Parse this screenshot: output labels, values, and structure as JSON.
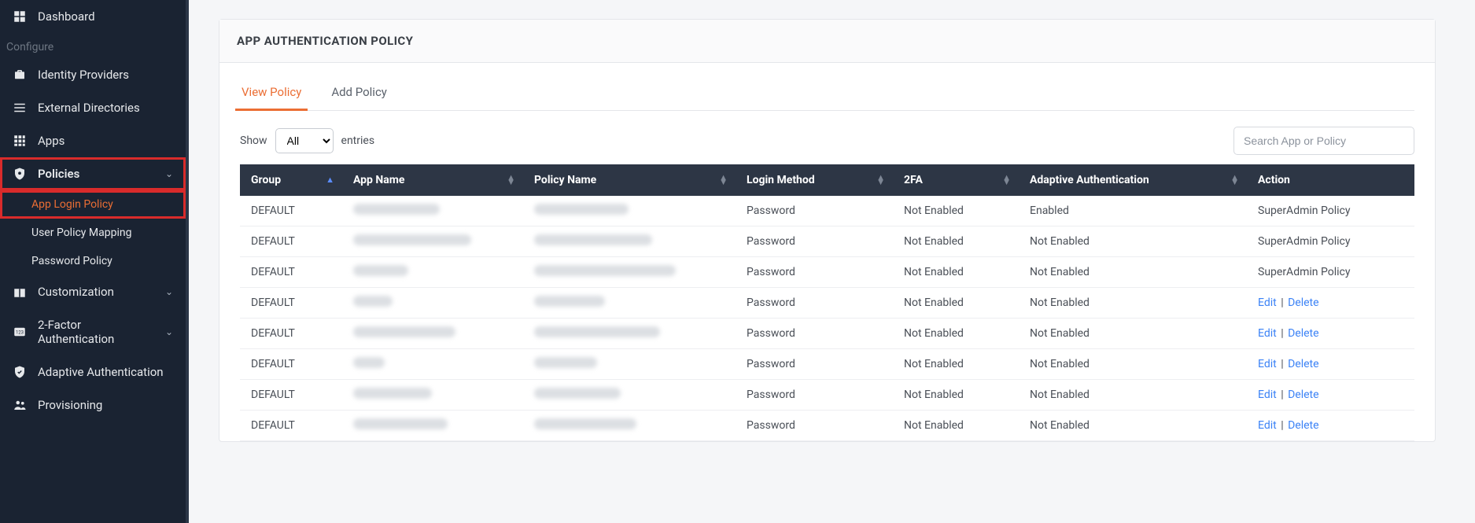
{
  "sidebar": {
    "dashboard": "Dashboard",
    "configure_label": "Configure",
    "identity_providers": "Identity Providers",
    "external_directories": "External Directories",
    "apps": "Apps",
    "policies": "Policies",
    "policies_sub": {
      "app_login": "App Login Policy",
      "user_policy_mapping": "User Policy Mapping",
      "password_policy": "Password Policy"
    },
    "customization": "Customization",
    "two_factor": "2-Factor Authentication",
    "adaptive_auth": "Adaptive Authentication",
    "provisioning": "Provisioning"
  },
  "page": {
    "title": "APP AUTHENTICATION POLICY",
    "tabs": {
      "view": "View Policy",
      "add": "Add Policy"
    },
    "show_label": "Show",
    "entries_label": "entries",
    "show_options": [
      "All"
    ],
    "show_selected": "All",
    "search_placeholder": "Search App or Policy"
  },
  "table": {
    "headers": {
      "group": "Group",
      "app_name": "App Name",
      "policy_name": "Policy Name",
      "login_method": "Login Method",
      "two_fa": "2FA",
      "adaptive": "Adaptive Authentication",
      "action": "Action"
    },
    "rows": [
      {
        "group": "DEFAULT",
        "app_blur_w": 110,
        "policy_blur_w": 120,
        "login": "Password",
        "twofa": "Not Enabled",
        "adaptive": "Enabled",
        "action_type": "text",
        "action_text": "SuperAdmin Policy"
      },
      {
        "group": "DEFAULT",
        "app_blur_w": 150,
        "policy_blur_w": 150,
        "login": "Password",
        "twofa": "Not Enabled",
        "adaptive": "Not Enabled",
        "action_type": "text",
        "action_text": "SuperAdmin Policy"
      },
      {
        "group": "DEFAULT",
        "app_blur_w": 70,
        "policy_blur_w": 180,
        "login": "Password",
        "twofa": "Not Enabled",
        "adaptive": "Not Enabled",
        "action_type": "text",
        "action_text": "SuperAdmin Policy"
      },
      {
        "group": "DEFAULT",
        "app_blur_w": 50,
        "policy_blur_w": 90,
        "login": "Password",
        "twofa": "Not Enabled",
        "adaptive": "Not Enabled",
        "action_type": "links",
        "edit": "Edit",
        "delete": "Delete"
      },
      {
        "group": "DEFAULT",
        "app_blur_w": 130,
        "policy_blur_w": 160,
        "login": "Password",
        "twofa": "Not Enabled",
        "adaptive": "Not Enabled",
        "action_type": "links",
        "edit": "Edit",
        "delete": "Delete"
      },
      {
        "group": "DEFAULT",
        "app_blur_w": 40,
        "policy_blur_w": 80,
        "login": "Password",
        "twofa": "Not Enabled",
        "adaptive": "Not Enabled",
        "action_type": "links",
        "edit": "Edit",
        "delete": "Delete"
      },
      {
        "group": "DEFAULT",
        "app_blur_w": 100,
        "policy_blur_w": 110,
        "login": "Password",
        "twofa": "Not Enabled",
        "adaptive": "Not Enabled",
        "action_type": "links",
        "edit": "Edit",
        "delete": "Delete"
      },
      {
        "group": "DEFAULT",
        "app_blur_w": 120,
        "policy_blur_w": 130,
        "login": "Password",
        "twofa": "Not Enabled",
        "adaptive": "Not Enabled",
        "action_type": "links",
        "edit": "Edit",
        "delete": "Delete"
      }
    ]
  },
  "colors": {
    "accent": "#eb6e34",
    "danger": "#e74c3c",
    "link": "#3b82f6",
    "sidebar_bg": "#1a2332",
    "table_header_bg": "#2d3645"
  }
}
